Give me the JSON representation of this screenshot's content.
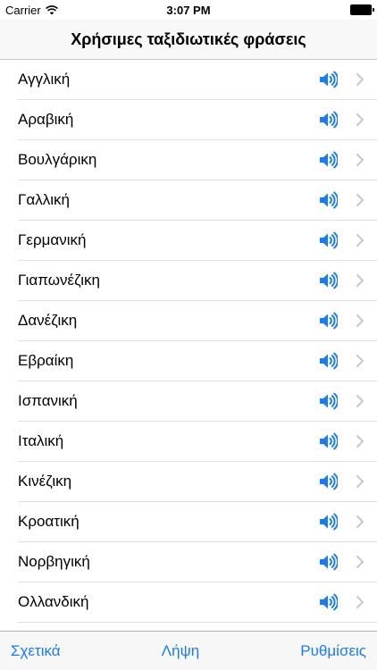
{
  "status_bar": {
    "carrier": "Carrier",
    "time": "3:07 PM"
  },
  "nav": {
    "title": "Χρήσιμες ταξιδιωτικές φράσεις"
  },
  "languages": [
    "Αγγλική",
    "Αραβική",
    "Βουλγάρικη",
    "Γαλλική",
    "Γερμανική",
    "Γιαπωνέζικη",
    "Δανέζικη",
    "Εβραίκη",
    "Ισπανική",
    "Ιταλική",
    "Κινέζικη",
    "Κροατική",
    "Νορβηγική",
    "Ολλανδική",
    ""
  ],
  "tabbar": {
    "about": "Σχετικά",
    "download": "Λήψη",
    "settings": "Ρυθμίσεις"
  },
  "colors": {
    "accent": "#1a7cf0",
    "chevron": "#c7c7cc",
    "separator": "#e0e0e4"
  },
  "icons": {
    "speaker": "speaker-icon",
    "chevron": "chevron-right-icon",
    "wifi": "wifi-icon",
    "battery": "battery-icon"
  }
}
